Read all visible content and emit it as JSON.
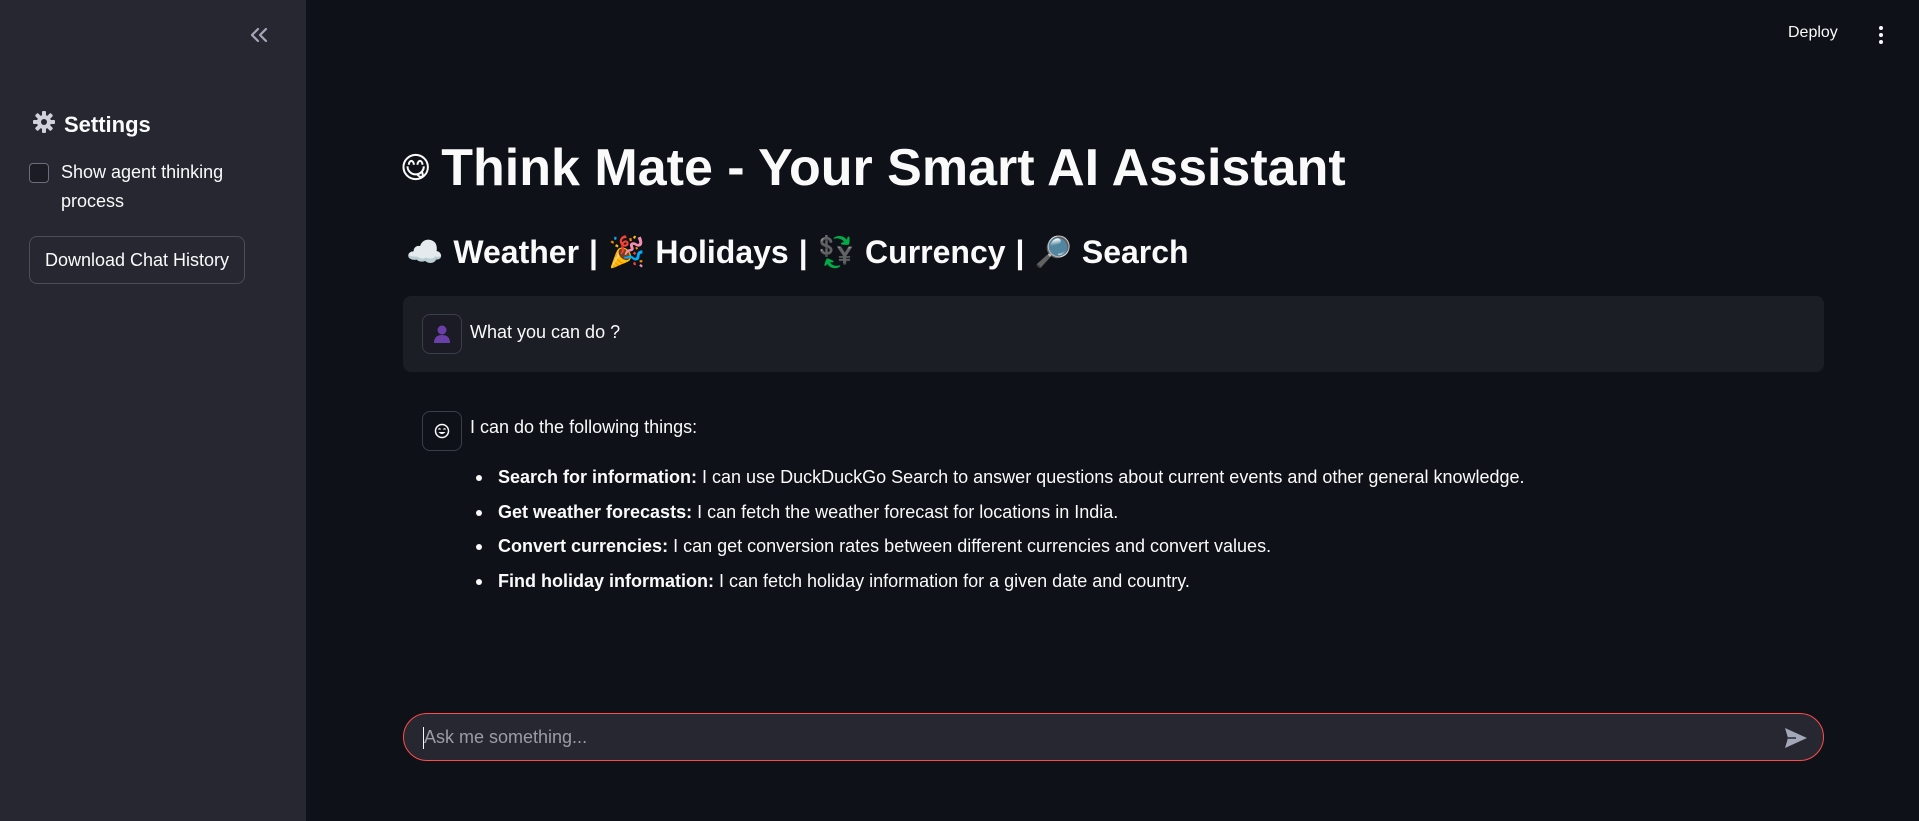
{
  "sidebar": {
    "settings_title": "Settings",
    "checkbox_label": "Show agent thinking process",
    "checkbox_checked": false,
    "download_button": "Download Chat History"
  },
  "header": {
    "deploy_label": "Deploy"
  },
  "main": {
    "title_emoji": "😋",
    "title": "Think Mate - Your Smart AI Assistant",
    "subtitle_parts": [
      {
        "emoji": "☁️",
        "label": "Weather"
      },
      {
        "separator": "|"
      },
      {
        "emoji": "🎉",
        "label": "Holidays"
      },
      {
        "separator": "|"
      },
      {
        "emoji": "💱",
        "label": "Currency"
      },
      {
        "separator": "|"
      },
      {
        "emoji": "🔎",
        "label": "Search"
      }
    ]
  },
  "chat": {
    "user_message": "What you can do ?",
    "bot_intro": "I can do the following things:",
    "bot_items": [
      {
        "bold": "Search for information:",
        "text": " I can use DuckDuckGo Search to answer questions about current events and other general knowledge."
      },
      {
        "bold": "Get weather forecasts:",
        "text": " I can fetch the weather forecast for locations in India."
      },
      {
        "bold": "Convert currencies:",
        "text": " I can get conversion rates between different currencies and convert values."
      },
      {
        "bold": "Find holiday information:",
        "text": " I can fetch holiday information for a given date and country."
      }
    ]
  },
  "input": {
    "placeholder": "Ask me something..."
  },
  "colors": {
    "background": "#0e1117",
    "sidebar": "#262730",
    "accent": "#ff4b4b"
  }
}
